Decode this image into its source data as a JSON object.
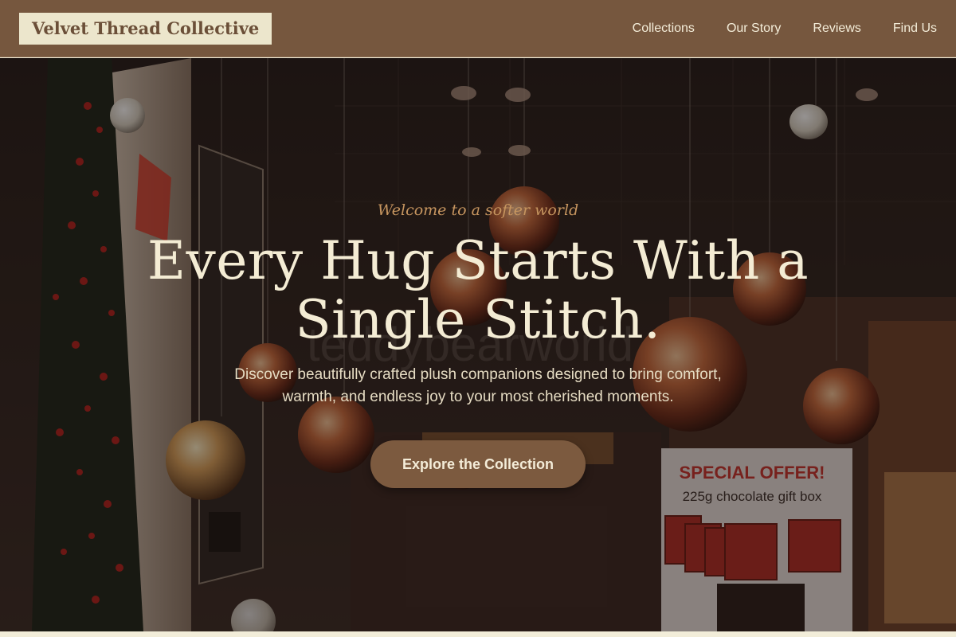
{
  "header": {
    "brand": "Velvet Thread Collective",
    "nav": [
      "Collections",
      "Our Story",
      "Reviews",
      "Find Us"
    ]
  },
  "hero": {
    "tagline": "Welcome to a softer world",
    "title": "Every Hug Starts With a Single Stitch.",
    "description": "Discover beautifully crafted plush companions designed to bring comfort, warmth, and endless joy to your most cherished moments.",
    "cta": "Explore the Collection",
    "background": {
      "storefront_sign": "teddybearworld",
      "offer_sign_line1": "SPECIAL OFFER!",
      "offer_sign_line2": "225g chocolate gift box"
    }
  },
  "colors": {
    "header_bg": "#76573e",
    "brand_bg": "#ece6cc",
    "accent": "#c6955f",
    "cta_bg": "#7c5a3f"
  }
}
